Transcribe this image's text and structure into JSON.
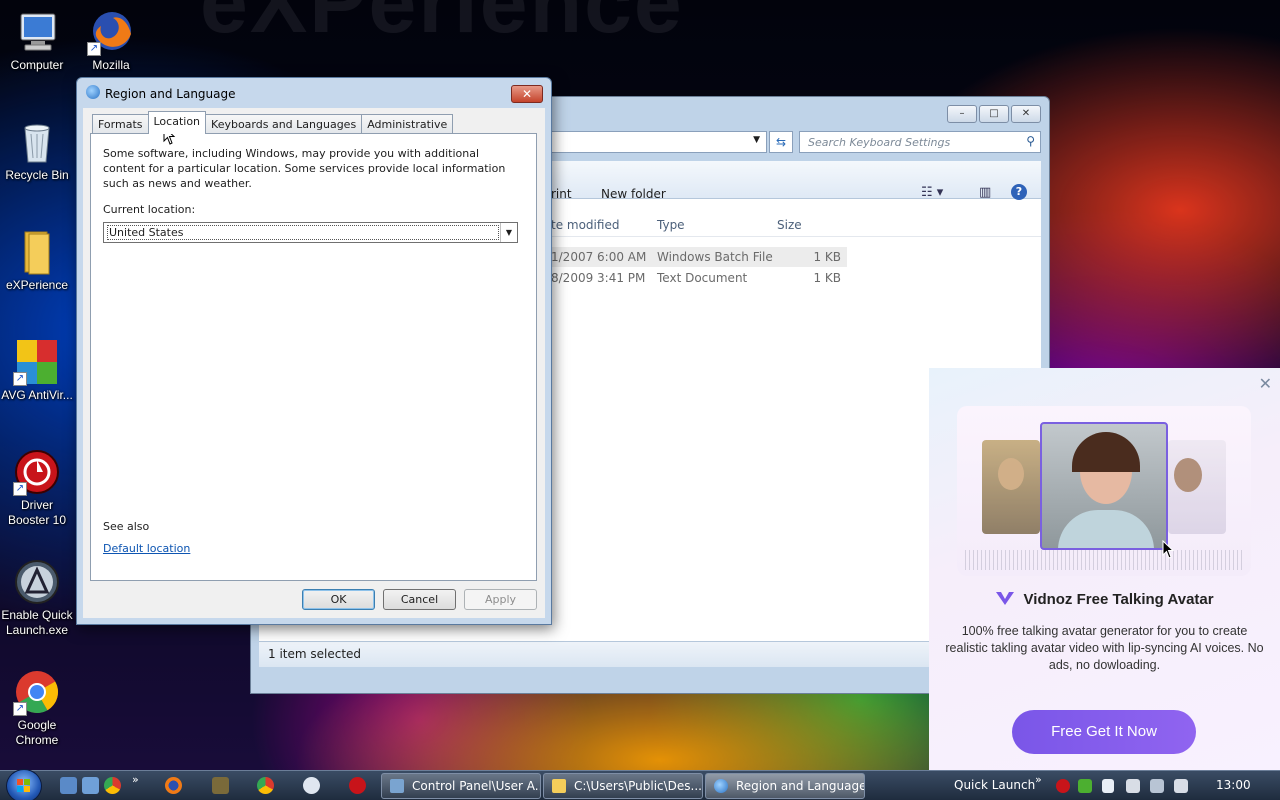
{
  "desktop": {
    "bg_watermark": "eXPerience",
    "icons": [
      {
        "label": "Computer"
      },
      {
        "label": "Mozilla"
      },
      {
        "label": "Recycle Bin"
      },
      {
        "label": "eXPerience"
      },
      {
        "label": "AVG AntiVir..."
      },
      {
        "label": "Driver Booster 10"
      },
      {
        "label": "Enable Quick Launch.exe"
      },
      {
        "label": "Google Chrome"
      }
    ]
  },
  "explorer": {
    "search_placeholder": "Search Keyboard Settings",
    "toolbar": {
      "print": "rint",
      "new_folder": "New folder"
    },
    "columns": {
      "date": "te modified",
      "type": "Type",
      "size": "Size"
    },
    "rows": [
      {
        "date": "1/2007 6:00 AM",
        "type": "Windows Batch File",
        "size": "1 KB"
      },
      {
        "date": "8/2009 3:41 PM",
        "type": "Text Document",
        "size": "1 KB"
      }
    ],
    "status": "1 item selected"
  },
  "dialog": {
    "title": "Region and Language",
    "tabs": [
      "Formats",
      "Location",
      "Keyboards and Languages",
      "Administrative"
    ],
    "active_tab": "Location",
    "description": "Some software, including Windows, may provide you with additional content for a particular location. Some services provide local information such as news and weather.",
    "current_location_label": "Current location:",
    "current_location_value": "United States",
    "see_also": "See also",
    "default_location_link": "Default location",
    "ok": "OK",
    "cancel": "Cancel",
    "apply": "Apply"
  },
  "ad": {
    "title": "Vidnoz Free Talking Avatar",
    "description": "100% free talking avatar generator for you to create realistic takling avatar video with lip-syncing AI voices. No ads, no dowloading.",
    "cta": "Free Get It Now"
  },
  "taskbar": {
    "tasks": [
      {
        "label": "Control Panel\\User A..."
      },
      {
        "label": "C:\\Users\\Public\\Des..."
      },
      {
        "label": "Region and Language"
      }
    ],
    "quick_launch": "Quick Launch",
    "clock": "13:00"
  },
  "colors": {
    "accent_link": "#0d55b2",
    "ad_button": "#7a56e8",
    "close_red": "#c4442c"
  }
}
